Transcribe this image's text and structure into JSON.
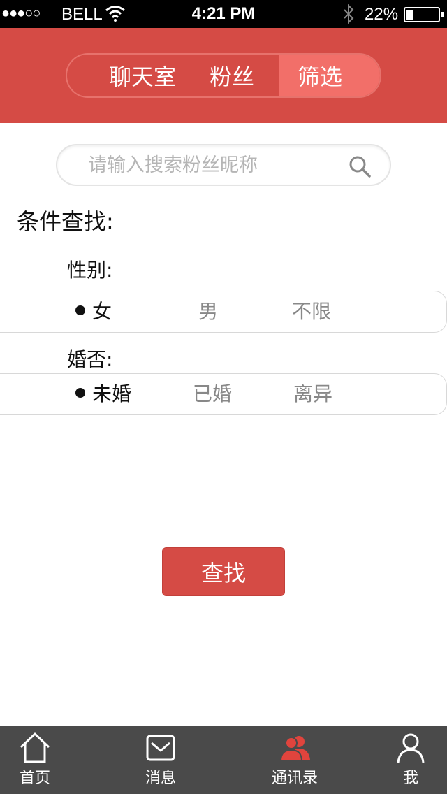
{
  "status_bar": {
    "signal": "●●●○○",
    "carrier": "BELL",
    "time": "4:21 PM",
    "battery_percent": "22%",
    "battery_level": 0.22
  },
  "segments": [
    {
      "label": "聊天室",
      "selected": false
    },
    {
      "label": "粉丝",
      "selected": false
    },
    {
      "label": "筛选",
      "selected": true
    }
  ],
  "search": {
    "placeholder": "请输入搜索粉丝昵称",
    "value": ""
  },
  "filter": {
    "title": "条件查找:",
    "gender": {
      "label": "性别:",
      "options": [
        {
          "label": "女",
          "selected": true
        },
        {
          "label": "男",
          "selected": false
        },
        {
          "label": "不限",
          "selected": false
        }
      ]
    },
    "marital": {
      "label": "婚否:",
      "options": [
        {
          "label": "未婚",
          "selected": true
        },
        {
          "label": "已婚",
          "selected": false
        },
        {
          "label": "离异",
          "selected": false
        }
      ]
    }
  },
  "find_button": {
    "label": "查找"
  },
  "tabbar": [
    {
      "label": "首页",
      "icon": "home-icon",
      "active": false
    },
    {
      "label": "消息",
      "icon": "mail-icon",
      "active": false
    },
    {
      "label": "通讯录",
      "icon": "contacts-icon",
      "active": true
    },
    {
      "label": "我",
      "icon": "user-icon",
      "active": false
    }
  ],
  "colors": {
    "brand_red": "#d54b45",
    "segment_selected": "#f26f69",
    "tabbar_bg": "#4a4a4a",
    "tab_active_icon": "#e0443d"
  }
}
